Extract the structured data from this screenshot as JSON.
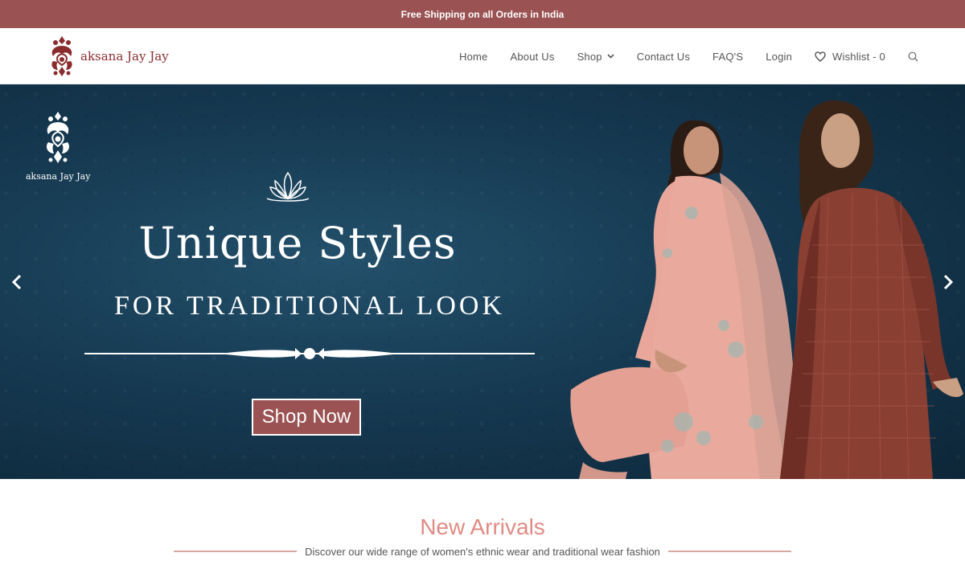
{
  "topbar": {
    "text": "Free Shipping on all Orders in India"
  },
  "header": {
    "logo_text": "aksana Jay Jay",
    "nav": {
      "home": "Home",
      "about": "About Us",
      "shop": "Shop",
      "contact": "Contact Us",
      "faq": "FAQ'S",
      "login": "Login",
      "wishlist": "Wishlist - 0"
    },
    "icons": {
      "shop_dropdown": "chevron-down-icon",
      "wishlist": "heart-icon",
      "search": "search-icon"
    }
  },
  "hero": {
    "brand_text": "aksana Jay Jay",
    "title": "Unique Styles",
    "subtitle": "FOR TRADITIONAL LOOK",
    "button_label": "Shop Now",
    "icons": {
      "prev": "chevron-left-icon",
      "next": "chevron-right-icon",
      "ornament": "lotus-icon"
    }
  },
  "section": {
    "title": "New Arrivals",
    "subtitle": "Discover our wide range of women's ethnic wear and traditional wear fashion"
  },
  "colors": {
    "brand": "#9a5253",
    "logo_red": "#8a2c2e",
    "hero_bg": "#163a52",
    "accent_pink": "#e08b84"
  }
}
